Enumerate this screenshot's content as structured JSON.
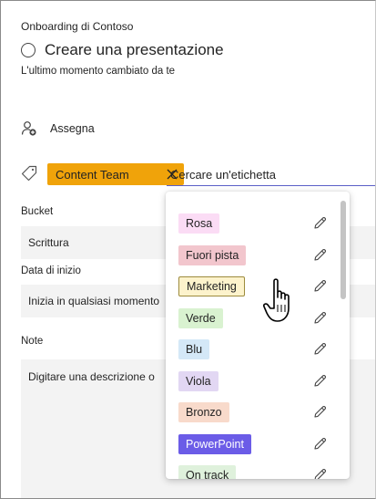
{
  "header": {
    "breadcrumb": "Onboarding di Contoso",
    "task_title": "Creare una presentazione",
    "last_changed": "L'ultimo momento cambiato da te"
  },
  "assign": {
    "label": "Assegna"
  },
  "labels": {
    "applied_tag": "Content Team",
    "applied_tag_color": "#f0a30a",
    "search_placeholder": "Cercare un'etichetta"
  },
  "fields": {
    "bucket_label": "Bucket",
    "bucket_value": "Scrittura",
    "start_label": "Data di inizio",
    "start_value": "Inizia in qualsiasi momento",
    "notes_label": "Note",
    "notes_placeholder": "Digitare una descrizione o"
  },
  "dropdown": {
    "items": [
      {
        "label": "Rosa",
        "bg": "#fbdcf5",
        "border": ""
      },
      {
        "label": "Fuori pista",
        "bg": "#f2c6cd",
        "border": ""
      },
      {
        "label": "Marketing",
        "bg": "#fdf3cc",
        "border": "#9d8b3d"
      },
      {
        "label": "Verde",
        "bg": "#d9f2d0",
        "border": ""
      },
      {
        "label": "Blu",
        "bg": "#d4e8f7",
        "border": ""
      },
      {
        "label": "Viola",
        "bg": "#e2d7f3",
        "border": ""
      },
      {
        "label": "Bronzo",
        "bg": "#f8dacb",
        "border": ""
      },
      {
        "label": "PowerPoint",
        "bg": "#6b5ce7",
        "border": "",
        "text": "#ffffff"
      },
      {
        "label": "On track",
        "bg": "#dff1dc",
        "border": ""
      }
    ],
    "highlighted_index": 2
  }
}
